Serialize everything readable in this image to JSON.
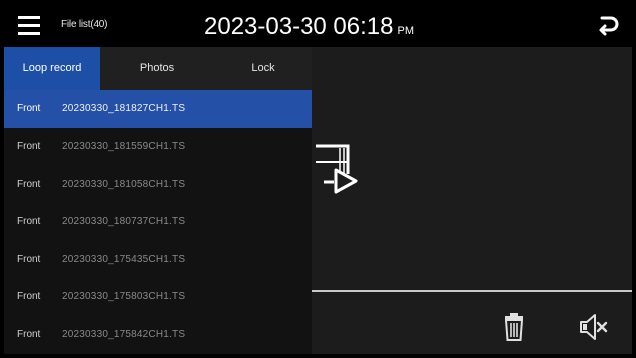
{
  "header": {
    "title": "File list(40)",
    "time": "2023-03-30 06:18",
    "ampm": "PM"
  },
  "tabs": [
    {
      "label": "Loop record",
      "active": true
    },
    {
      "label": "Photos",
      "active": false
    },
    {
      "label": "Lock",
      "active": false
    }
  ],
  "files": [
    {
      "camera": "Front",
      "name": "20230330_181827CH1.TS",
      "selected": true
    },
    {
      "camera": "Front",
      "name": "20230330_181559CH1.TS",
      "selected": false
    },
    {
      "camera": "Front",
      "name": "20230330_181058CH1.TS",
      "selected": false
    },
    {
      "camera": "Front",
      "name": "20230330_180737CH1.TS",
      "selected": false
    },
    {
      "camera": "Front",
      "name": "20230330_175435CH1.TS",
      "selected": false
    },
    {
      "camera": "Front",
      "name": "20230330_175803CH1.TS",
      "selected": false
    },
    {
      "camera": "Front",
      "name": "20230330_175842CH1.TS",
      "selected": false
    }
  ],
  "icons": {
    "menu": "menu-icon",
    "back": "back-arrow-icon",
    "play": "play-icon",
    "trash": "trash-icon",
    "volume": "volume-mute-icon"
  },
  "colors": {
    "accent": "#1e4fa6",
    "selected_row": "#2450a8",
    "background": "#1c1c1c",
    "topbar": "#000000"
  }
}
